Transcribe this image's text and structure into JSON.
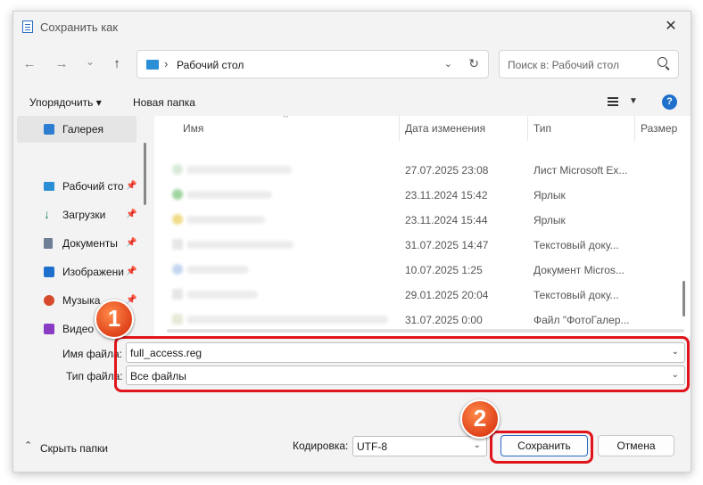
{
  "window": {
    "title": "Сохранить как"
  },
  "navigation": {
    "back": "←",
    "forward": "→",
    "recent": "⌄",
    "up": "↑",
    "address": {
      "separator": "›",
      "location": "Рабочий стол"
    },
    "search_placeholder": "Поиск в: Рабочий стол"
  },
  "toolbar": {
    "organize": "Упорядочить ▾",
    "new_folder": "Новая папка"
  },
  "sidebar": {
    "items": [
      {
        "label": "Галерея",
        "icon": "gallery-icon",
        "pinned": false
      },
      {
        "label": "Рабочий сто",
        "icon": "desktop-icon",
        "pinned": true
      },
      {
        "label": "Загрузки",
        "icon": "download-icon",
        "pinned": true
      },
      {
        "label": "Документы",
        "icon": "documents-icon",
        "pinned": true
      },
      {
        "label": "Изображени",
        "icon": "pictures-icon",
        "pinned": true
      },
      {
        "label": "Музыка",
        "icon": "music-icon",
        "pinned": true
      },
      {
        "label": "Видео",
        "icon": "video-icon",
        "pinned": false
      }
    ]
  },
  "file_list": {
    "columns": [
      "Имя",
      "Дата изменения",
      "Тип",
      "Размер"
    ],
    "rows": [
      {
        "date": "27.07.2025 23:08",
        "type": "Лист Microsoft Ex..."
      },
      {
        "date": "23.11.2024 15:42",
        "type": "Ярлык"
      },
      {
        "date": "23.11.2024 15:44",
        "type": "Ярлык"
      },
      {
        "date": "31.07.2025 14:47",
        "type": "Текстовый доку..."
      },
      {
        "date": "10.07.2025 1:25",
        "type": "Документ Micros..."
      },
      {
        "date": "29.01.2025 20:04",
        "type": "Текстовый доку..."
      },
      {
        "date": "31.07.2025 0:00",
        "type": "Файл \"ФотоГалер..."
      }
    ]
  },
  "form": {
    "filename_label": "Имя файла:",
    "filename_value": "full_access.reg",
    "filetype_label": "Тип файла:",
    "filetype_value": "Все файлы"
  },
  "footer": {
    "hide_folders": "Скрыть папки",
    "encoding_label": "Кодировка:",
    "encoding_value": "UTF-8",
    "save": "Сохранить",
    "cancel": "Отмена"
  },
  "annotations": {
    "badge1": "1",
    "badge2": "2",
    "color": "#e0141a"
  }
}
